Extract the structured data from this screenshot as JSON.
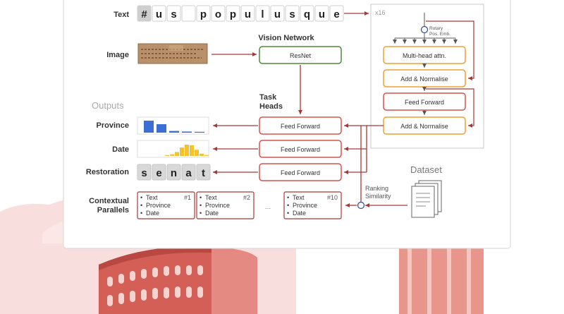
{
  "labels": {
    "text": "Text",
    "image": "Image",
    "outputs": "Outputs",
    "province": "Province",
    "date": "Date",
    "restoration": "Restoration",
    "contextual_line1": "Contextual",
    "contextual_line2": "Parallels",
    "vision_network": "Vision Network",
    "task_heads_line1": "Task",
    "task_heads_line2": "Heads",
    "ranking_line1": "Ranking",
    "ranking_line2": "Similarity",
    "dataset": "Dataset",
    "repeat": "x16",
    "rotary_line1": "Rotary",
    "rotary_line2": "Pos. Emb.",
    "ellipsis": "..."
  },
  "input_chars": [
    "#",
    "u",
    "s",
    "",
    "p",
    "o",
    "p",
    "u",
    "l",
    "u",
    "s",
    "q",
    "u",
    "e"
  ],
  "restoration_chars": [
    "s",
    "e",
    "n",
    "a",
    "t"
  ],
  "blocks": {
    "resnet": "ResNet",
    "mha": "Multi-head attn.",
    "addnorm1": "Add & Normalise",
    "ff_block": "Feed Forward",
    "addnorm2": "Add & Normalise",
    "head_province": "Feed Forward",
    "head_date": "Feed Forward",
    "head_restoration": "Feed Forward"
  },
  "parallel_cards": [
    {
      "num": "#1",
      "items": [
        "Text",
        "Province",
        "Date"
      ]
    },
    {
      "num": "#2",
      "items": [
        "Text",
        "Province",
        "Date"
      ]
    },
    {
      "num": "#10",
      "items": [
        "Text",
        "Province",
        "Date"
      ]
    }
  ],
  "chart_data": [
    {
      "type": "bar",
      "role": "province-distribution",
      "values": [
        0.85,
        0.6,
        0.12,
        0.08,
        0.06
      ],
      "color": "#3b6fd6"
    },
    {
      "type": "bar",
      "role": "date-distribution",
      "values": [
        0.08,
        0.15,
        0.35,
        0.75,
        1.0,
        0.95,
        0.55,
        0.2,
        0.08
      ],
      "color": "#f2c230"
    }
  ],
  "colors": {
    "arrow": "#a33a35",
    "green": "#4d8a3a",
    "orange": "#f0a030",
    "red": "#d9534f",
    "dataset_pillar": "#e8958c",
    "colosseum": "#d35f57"
  }
}
